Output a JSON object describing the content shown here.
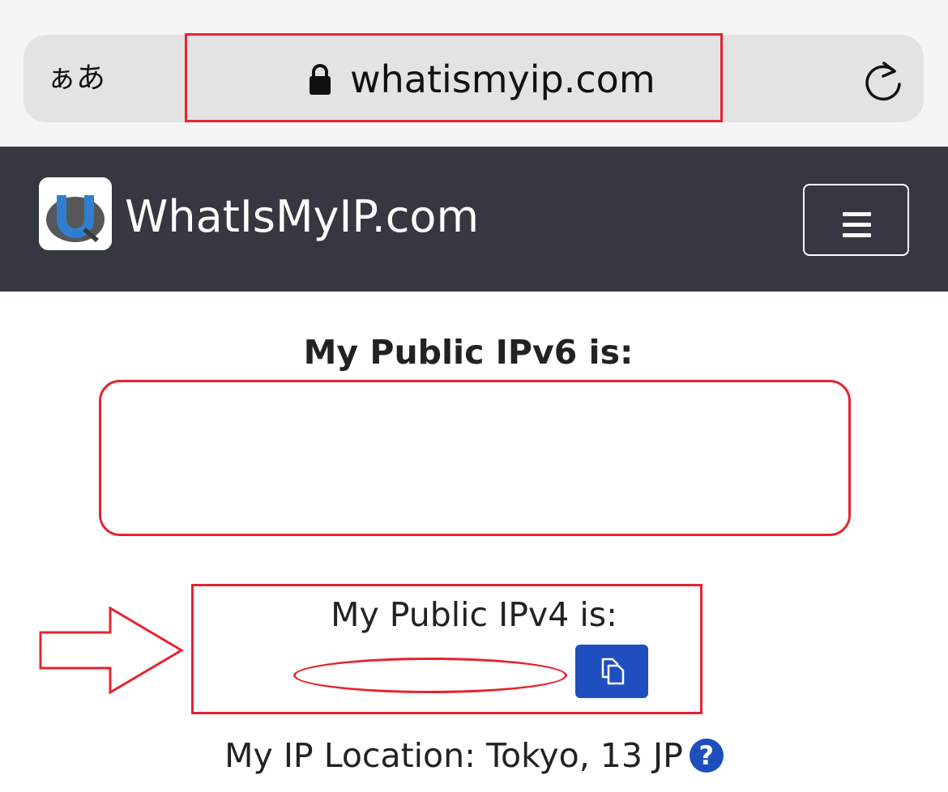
{
  "browser": {
    "text_size_label": "ぁあ",
    "url": "whatismyip.com",
    "icons": {
      "lock": "lock-icon",
      "reload": "reload-icon"
    }
  },
  "navbar": {
    "site_name": "WhatIsMyIP.com",
    "logo": "whatismyip-logo",
    "menu_icon": "hamburger-menu-icon"
  },
  "main": {
    "ipv6_heading": "My Public IPv6 is:",
    "ipv4_heading": "My Public IPv4 is:",
    "copy_icon": "copy-icon",
    "location_text": "My IP Location: Tokyo, 13 JP",
    "help_icon_glyph": "?"
  },
  "colors": {
    "annotation_red": "#e5242e",
    "navbar_bg": "#353840",
    "button_blue": "#1f4fbf",
    "address_bar_bg": "#e3e3e3"
  }
}
